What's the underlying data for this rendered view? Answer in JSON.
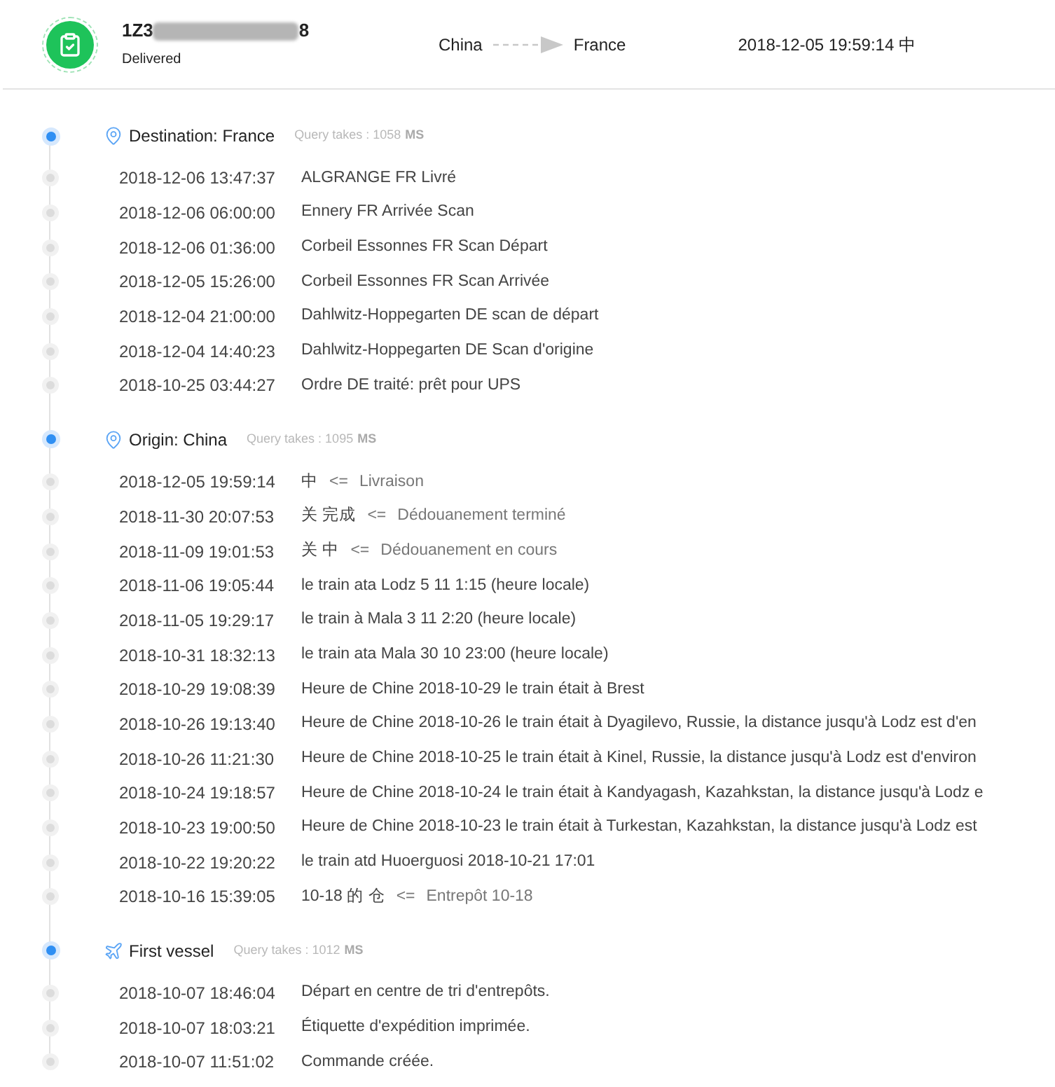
{
  "shipment": {
    "tracking_prefix": "1Z3",
    "tracking_suffix": "8",
    "tracking_blurred": true,
    "status": "Delivered",
    "origin": "China",
    "destination": "France",
    "latest_time": "2018-12-05 19:59:14 中"
  },
  "sections": [
    {
      "kind": "place",
      "title": "Destination: France",
      "query_label": "Query takes : 1058",
      "query_unit": "MS",
      "events": [
        {
          "time": "2018-12-06 13:47:37",
          "text": "ALGRANGE FR Livré"
        },
        {
          "time": "2018-12-06 06:00:00",
          "text": "Ennery FR Arrivée Scan"
        },
        {
          "time": "2018-12-06 01:36:00",
          "text": "Corbeil Essonnes FR Scan Départ"
        },
        {
          "time": "2018-12-05 15:26:00",
          "text": "Corbeil Essonnes FR Scan Arrivée"
        },
        {
          "time": "2018-12-04 21:00:00",
          "text": "Dahlwitz-Hoppegarten DE scan de départ"
        },
        {
          "time": "2018-12-04 14:40:23",
          "text": "Dahlwitz-Hoppegarten DE Scan d'origine"
        },
        {
          "time": "2018-10-25 03:44:27",
          "text": "Ordre DE traité: prêt pour UPS"
        }
      ]
    },
    {
      "kind": "place",
      "title": "Origin: China",
      "query_label": "Query takes : 1095",
      "query_unit": "MS",
      "events": [
        {
          "time": "2018-12-05 19:59:14",
          "text": "中",
          "marker": "<=",
          "translation": "Livraison"
        },
        {
          "time": "2018-11-30 20:07:53",
          "text": "关 完成",
          "marker": "<=",
          "translation": "Dédouanement terminé"
        },
        {
          "time": "2018-11-09 19:01:53",
          "text": "关 中",
          "marker": "<=",
          "translation": "Dédouanement en cours"
        },
        {
          "time": "2018-11-06 19:05:44",
          "text": "le train ata Lodz 5 11 1:15 (heure locale)"
        },
        {
          "time": "2018-11-05 19:29:17",
          "text": "le train à Mala 3 11 2:20 (heure locale)"
        },
        {
          "time": "2018-10-31 18:32:13",
          "text": "le train ata Mala 30 10 23:00 (heure locale)"
        },
        {
          "time": "2018-10-29 19:08:39",
          "text": "Heure de Chine 2018-10-29 le train était à Brest"
        },
        {
          "time": "2018-10-26 19:13:40",
          "text": "Heure de Chine 2018-10-26 le train était à Dyagilevo, Russie, la distance jusqu'à Lodz est d'en"
        },
        {
          "time": "2018-10-26 11:21:30",
          "text": "Heure de Chine 2018-10-25 le train était à Kinel, Russie, la distance jusqu'à Lodz est d'environ"
        },
        {
          "time": "2018-10-24 19:18:57",
          "text": "Heure de Chine 2018-10-24 le train était à Kandyagash, Kazahkstan, la distance jusqu'à Lodz e"
        },
        {
          "time": "2018-10-23 19:00:50",
          "text": "Heure de Chine 2018-10-23 le train était à Turkestan, Kazahkstan, la distance jusqu'à Lodz est"
        },
        {
          "time": "2018-10-22 19:20:22",
          "text": "le train atd Huoerguosi 2018-10-21 17:01"
        },
        {
          "time": "2018-10-16 15:39:05",
          "text": "10-18 的 仓",
          "marker": "<=",
          "translation": "Entrepôt 10-18"
        }
      ]
    },
    {
      "kind": "vessel",
      "title": "First vessel",
      "query_label": "Query takes : 1012",
      "query_unit": "MS",
      "events": [
        {
          "time": "2018-10-07 18:46:04",
          "text": "Départ en centre de tri d'entrepôts."
        },
        {
          "time": "2018-10-07 18:03:21",
          "text": "Étiquette d'expédition imprimée."
        },
        {
          "time": "2018-10-07 11:51:02",
          "text": "Commande créée."
        }
      ]
    }
  ]
}
